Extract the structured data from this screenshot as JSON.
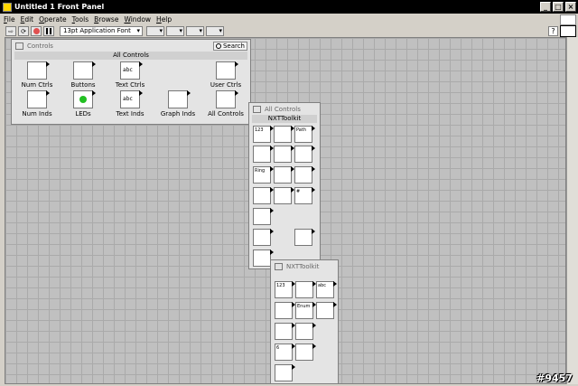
{
  "window": {
    "title": "Untitled 1 Front Panel"
  },
  "menu": [
    "File",
    "Edit",
    "Operate",
    "Tools",
    "Browse",
    "Window",
    "Help"
  ],
  "toolbar": {
    "font": "13pt Application Font"
  },
  "controls_palette": {
    "title": "Controls",
    "search_label": "Search",
    "section": "All Controls",
    "items": [
      "Num Ctrls",
      "Buttons",
      "Text Ctrls",
      "User Ctrls",
      "Num Inds",
      "LEDs",
      "Text Inds",
      "Graph Inds",
      "All Controls"
    ]
  },
  "all_controls_palette": {
    "title": "All Controls",
    "section": "NXTToolkit"
  },
  "nxt_palette": {
    "title": "NXTToolkit"
  },
  "icon_text": {
    "num": "123",
    "abc": "abc",
    "path": "Path",
    "ring": "Ring",
    "enum": "Enum",
    "six": "6",
    "hash": "#"
  },
  "watermark": "#9457"
}
